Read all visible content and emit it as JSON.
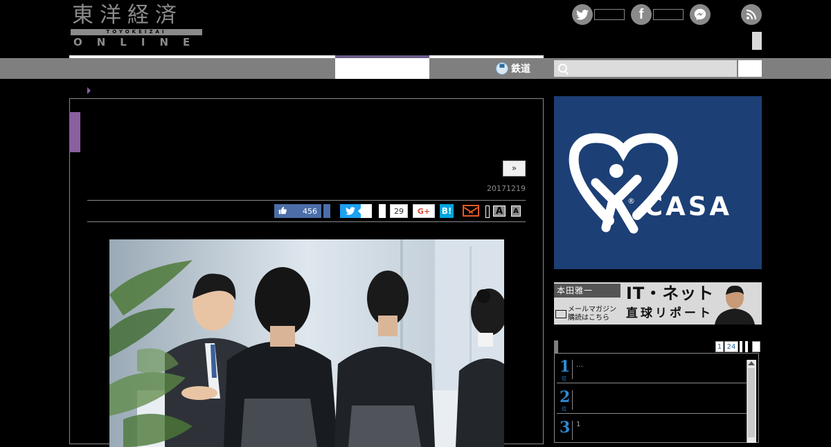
{
  "header": {
    "logo_main": "東洋経済",
    "logo_romaji": "TOYOKEIZAI",
    "logo_sub": "ONLINE"
  },
  "nav": {
    "active_index": 1,
    "railway_label": "鉄道",
    "search_placeholder": ""
  },
  "article": {
    "next_label": "»",
    "date": "20171219",
    "share": {
      "like_count": "456",
      "comment_count": "29",
      "gplus_label": "G+",
      "hatena_label": "B!",
      "font_large": "A",
      "font_small": "A"
    }
  },
  "ads": {
    "casa": {
      "brand": "CASA",
      "reg_mark": "®"
    },
    "it_net": {
      "author": "本田雅一",
      "title1": "IT・ネット",
      "title2": "直球リポート",
      "mail_line1": "メールマガジン",
      "mail_line2": "購読はこちら"
    }
  },
  "ranking": {
    "tabs": [
      "1",
      "24"
    ],
    "rank_suffix": "位",
    "items": [
      {
        "rank": "1",
        "text": "…"
      },
      {
        "rank": "2",
        "text": ""
      },
      {
        "rank": "3",
        "text": "1"
      }
    ]
  },
  "colors": {
    "accent_purple": "#8b5fa0",
    "nav_gray": "#7f7f7f",
    "facebook": "#4c6ea8",
    "twitter": "#1da1f2",
    "hatena": "#00a4de",
    "casa_blue": "#1c3f76",
    "rank_blue": "#2e8ad2"
  },
  "icons": [
    "twitter-icon",
    "facebook-icon",
    "messenger-icon",
    "rss-icon",
    "search-icon",
    "railway-icon",
    "thumbs-up-icon",
    "mail-icon",
    "casa-logo-icon"
  ]
}
